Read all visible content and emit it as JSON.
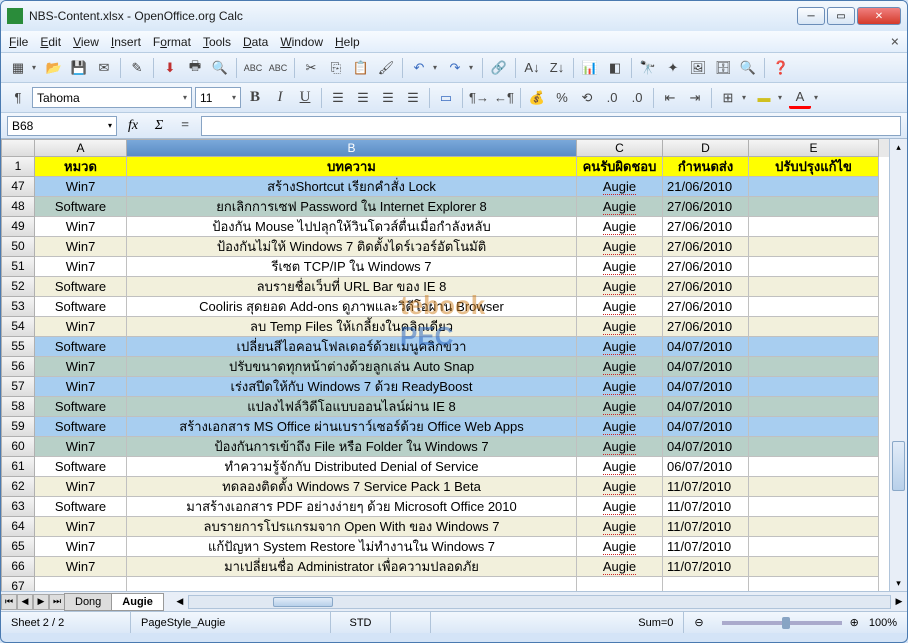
{
  "window": {
    "title": "NBS-Content.xlsx - OpenOffice.org Calc"
  },
  "menu": {
    "file": "File",
    "edit": "Edit",
    "view": "View",
    "insert": "Insert",
    "format": "Format",
    "tools": "Tools",
    "data": "Data",
    "window": "Window",
    "help": "Help"
  },
  "formula": {
    "cellref": "B68"
  },
  "format": {
    "font": "Tahoma",
    "size": "11"
  },
  "columns": {
    "A": "A",
    "B": "B",
    "C": "C",
    "D": "D",
    "E": "E"
  },
  "headers": {
    "A": "หมวด",
    "B": "บทความ",
    "C": "คนรับผิดชอบ",
    "D": "กำหนดส่ง",
    "E": "ปรับปรุงแก้ไข"
  },
  "rows": [
    {
      "n": "47",
      "a": "Win7",
      "b": "สร้างShortcut เรียกคำสั่ง Lock",
      "c": "Augie",
      "d": "21/06/2010",
      "alt": false
    },
    {
      "n": "48",
      "a": "Software",
      "b": "ยกเลิกการเซฟ Password ใน Internet Explorer 8",
      "c": "Augie",
      "d": "27/06/2010",
      "alt": true
    },
    {
      "n": "49",
      "a": "Win7",
      "b": "ป้องกัน Mouse ไปปลุกให้วินโดวส์ตื่นเมื่อกำลังหลับ",
      "c": "Augie",
      "d": "27/06/2010",
      "alt": false
    },
    {
      "n": "50",
      "a": "Win7",
      "b": "ป้องกันไม่ให้ Windows 7 ติดตั้งไดร์เวอร์อัตโนมัติ",
      "c": "Augie",
      "d": "27/06/2010",
      "alt": true
    },
    {
      "n": "51",
      "a": "Win7",
      "b": "รีเซต TCP/IP ใน Windows 7",
      "c": "Augie",
      "d": "27/06/2010",
      "alt": false
    },
    {
      "n": "52",
      "a": "Software",
      "b": "ลบรายชื่อเว็บที่ URL Bar ของ IE 8",
      "c": "Augie",
      "d": "27/06/2010",
      "alt": true
    },
    {
      "n": "53",
      "a": "Software",
      "b": "Cooliris สุดยอด Add-ons ดูภาพและวิดีโอผ่าน Browser",
      "c": "Augie",
      "d": "27/06/2010",
      "alt": false
    },
    {
      "n": "54",
      "a": "Win7",
      "b": "ลบ Temp Files ให้เกลี้ยงในคลิกเดียว",
      "c": "Augie",
      "d": "27/06/2010",
      "alt": true
    },
    {
      "n": "55",
      "a": "Software",
      "b": "เปลี่ยนสีไอคอนโฟลเดอร์ด้วยเมนูคลิกขวา",
      "c": "Augie",
      "d": "04/07/2010",
      "alt": false
    },
    {
      "n": "56",
      "a": "Win7",
      "b": "ปรับขนาดทุกหน้าต่างด้วยลูกเล่น Auto Snap",
      "c": "Augie",
      "d": "04/07/2010",
      "alt": true
    },
    {
      "n": "57",
      "a": "Win7",
      "b": "เร่งสปีดให้กับ Windows 7 ด้วย ReadyBoost",
      "c": "Augie",
      "d": "04/07/2010",
      "alt": false
    },
    {
      "n": "58",
      "a": "Software",
      "b": "แปลงไฟล์วิดีโอแบบออนไลน์ผ่าน IE 8",
      "c": "Augie",
      "d": "04/07/2010",
      "alt": true
    },
    {
      "n": "59",
      "a": "Software",
      "b": "สร้างเอกสาร MS Office ผ่านเบราว์เซอร์ด้วย Office Web Apps",
      "c": "Augie",
      "d": "04/07/2010",
      "alt": false
    },
    {
      "n": "60",
      "a": "Win7",
      "b": "ป้องกันการเข้าถึง File หรือ Folder ใน Windows 7",
      "c": "Augie",
      "d": "04/07/2010",
      "alt": true
    },
    {
      "n": "61",
      "a": "Software",
      "b": "ทำความรู้จักกับ Distributed Denial of Service",
      "c": "Augie",
      "d": "06/07/2010",
      "alt": false
    },
    {
      "n": "62",
      "a": "Win7",
      "b": "ทดลองติดตั้ง Windows 7 Service Pack 1 Beta",
      "c": "Augie",
      "d": "11/07/2010",
      "alt": true
    },
    {
      "n": "63",
      "a": "Software",
      "b": "มาสร้างเอกสาร PDF อย่างง่ายๆ ด้วย Microsoft Office 2010",
      "c": "Augie",
      "d": "11/07/2010",
      "alt": false
    },
    {
      "n": "64",
      "a": "Win7",
      "b": "ลบรายการโปรแกรมจาก Open With ของ Windows 7",
      "c": "Augie",
      "d": "11/07/2010",
      "alt": true
    },
    {
      "n": "65",
      "a": "Win7",
      "b": "แก้ปัญหา System Restore ไม่ทำงานใน Windows 7",
      "c": "Augie",
      "d": "11/07/2010",
      "alt": false
    },
    {
      "n": "66",
      "a": "Win7",
      "b": "มาเปลี่ยนชื่อ Administrator เพื่อความปลอดภัย",
      "c": "Augie",
      "d": "11/07/2010",
      "alt": true
    },
    {
      "n": "67",
      "a": "",
      "b": "",
      "c": "",
      "d": "",
      "alt": false
    }
  ],
  "selected_rows": [
    "47",
    "48",
    "55",
    "56",
    "57",
    "58",
    "59",
    "60"
  ],
  "tabs": {
    "t1": "Dong",
    "t2": "Augie"
  },
  "status": {
    "sheet": "Sheet 2 / 2",
    "style": "PageStyle_Augie",
    "mode": "STD",
    "sum": "Sum=0",
    "zoom": "100%"
  },
  "watermark": {
    "t1": "tebook",
    "t2": "PEC"
  }
}
